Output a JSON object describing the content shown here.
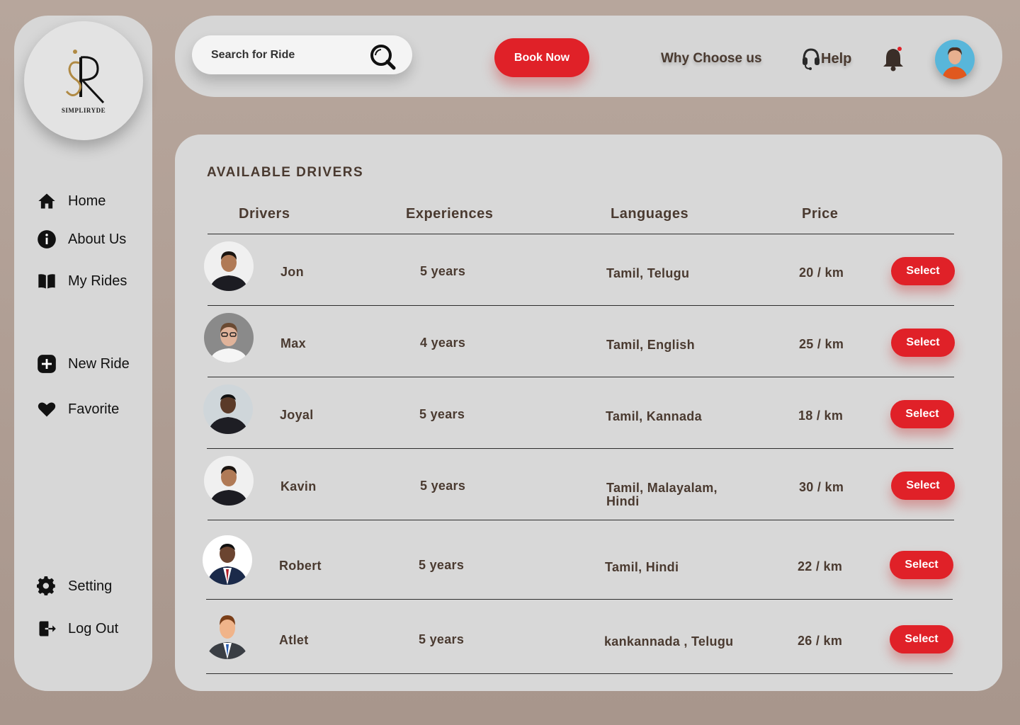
{
  "brand": {
    "name": "SIMPLIRYDE"
  },
  "sidebar": {
    "items": [
      {
        "label": "Home",
        "icon": "home-icon"
      },
      {
        "label": "About Us",
        "icon": "info-icon"
      },
      {
        "label": "My Rides",
        "icon": "book-icon"
      },
      {
        "label": "New Ride",
        "icon": "plus-icon"
      },
      {
        "label": "Favorite",
        "icon": "heart-icon"
      },
      {
        "label": "Setting",
        "icon": "gear-icon"
      },
      {
        "label": "Log Out",
        "icon": "logout-icon"
      }
    ]
  },
  "header": {
    "search_placeholder": "Search for Ride",
    "book_label": "Book Now",
    "why_label": "Why Choose us",
    "help_label": "Help",
    "notification_dot": true
  },
  "main": {
    "title": "AVAILABLE DRIVERS",
    "columns": [
      "Drivers",
      "Experiences",
      "Languages",
      "Price"
    ],
    "select_label": "Select",
    "rows": [
      {
        "name": "Jon",
        "experience": "5 years",
        "languages": "Tamil, Telugu",
        "price": "20 / km"
      },
      {
        "name": "Max",
        "experience": "4 years",
        "languages": "Tamil, English",
        "price": "25 / km"
      },
      {
        "name": "Joyal",
        "experience": "5 years",
        "languages": "Tamil, Kannada",
        "price": "18 / km"
      },
      {
        "name": "Kavin",
        "experience": "5 years",
        "languages": "Tamil, Malayalam,\nHindi",
        "price": "30 / km"
      },
      {
        "name": "Robert",
        "experience": "5 years",
        "languages": "Tamil, Hindi",
        "price": "22 / km"
      },
      {
        "name": "Atlet",
        "experience": "5 years",
        "languages": "kankannada , Telugu",
        "price": "26 / km"
      }
    ]
  },
  "colors": {
    "accent": "#e02128",
    "text_brown": "#4a3a30",
    "background": "#b7a69c",
    "panel": "#d8d8d8"
  }
}
